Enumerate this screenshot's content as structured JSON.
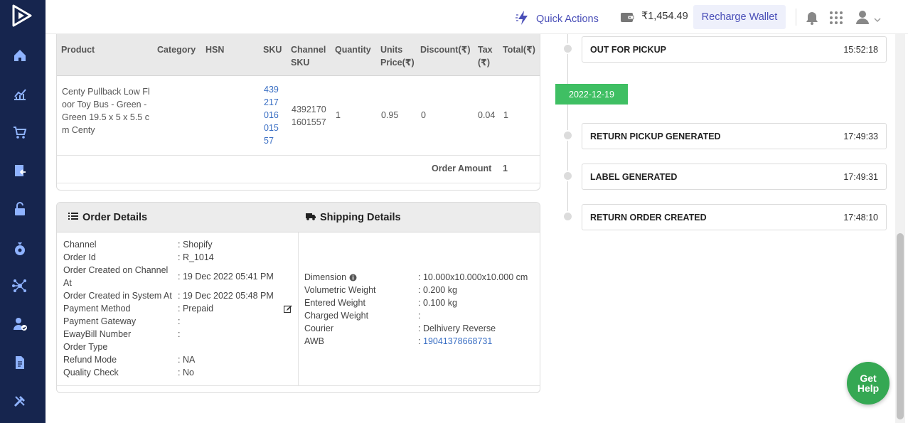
{
  "topbar": {
    "quick_actions": "Quick Actions",
    "wallet_amount": "₹1,454.49",
    "recharge_label": "Recharge Wallet"
  },
  "product_table": {
    "headers": {
      "product": "Product",
      "category": "Category",
      "hsn": "HSN",
      "sku": "SKU",
      "channel_sku_1": "Channel",
      "channel_sku_2": "SKU",
      "quantity": "Quantity",
      "units_price_1": "Units",
      "units_price_2": "Price(₹)",
      "discount": "Discount(₹)",
      "tax_1": "Tax",
      "tax_2": "(₹)",
      "total": "Total(₹)"
    },
    "row": {
      "product_lines": [
        "Centy Pullback Low Fl",
        "oor Toy Bus - Green -",
        "Green 19.5 x 5 x 5.5 c",
        "m Centy"
      ],
      "sku_lines": [
        "439",
        "217",
        "016",
        "015",
        "57"
      ],
      "channel_sku_lines": [
        "4392170",
        "1601557"
      ],
      "quantity": "1",
      "units_price": "0.95",
      "discount": "0",
      "tax": "0.04",
      "total": "1"
    },
    "order_amount_label": "Order Amount",
    "order_amount_value": "1"
  },
  "order_details": {
    "title": "Order Details",
    "fields": {
      "channel_label": "Channel",
      "channel_value": ": Shopify",
      "order_id_label": "Order Id",
      "order_id_value": ": R_1014",
      "created_channel_label_1": "Order Created on Channel",
      "created_channel_label_2": "At",
      "created_channel_value": ": 19 Dec 2022 05:41 PM",
      "created_system_label": "Order Created in System At",
      "created_system_value": ": 19 Dec 2022 05:48 PM",
      "payment_method_label": "Payment Method",
      "payment_method_value": ": Prepaid",
      "payment_gateway_label": "Payment Gateway",
      "payment_gateway_value": ":",
      "eway_label": "EwayBill Number",
      "eway_value": ":",
      "order_type_label": "Order Type",
      "refund_mode_label": "Refund Mode",
      "refund_mode_value": ": NA",
      "quality_check_label": "Quality Check",
      "quality_check_value": ": No"
    }
  },
  "shipping_details": {
    "title": "Shipping Details",
    "fields": {
      "dimension_label": "Dimension",
      "dimension_value": ": 10.000x10.000x10.000 cm",
      "vol_weight_label": "Volumetric Weight",
      "vol_weight_value": ":  0.200 kg",
      "entered_weight_label": "Entered Weight",
      "entered_weight_value": ":  0.100 kg",
      "charged_weight_label": "Charged Weight",
      "charged_weight_value": ":",
      "courier_label": "Courier",
      "courier_value": ": Delhivery Reverse",
      "awb_label": "AWB",
      "awb_colon": ":",
      "awb_value": "19041378668731"
    }
  },
  "timeline": {
    "date_pill": "2022-12-19",
    "events": [
      {
        "status": "OUT FOR PICKUP",
        "time": "15:52:18"
      },
      {
        "status": "RETURN PICKUP GENERATED",
        "time": "17:49:33"
      },
      {
        "status": "LABEL GENERATED",
        "time": "17:49:31"
      },
      {
        "status": "RETURN ORDER CREATED",
        "time": "17:48:10"
      }
    ]
  },
  "help": {
    "line1": "Get",
    "line2": "Help"
  },
  "colors": {
    "sidebar": "#16254e",
    "accent": "#4a4fb8",
    "green": "#3fbf63",
    "link": "#3a6fc4"
  },
  "icons": [
    "logo-icon",
    "home-icon",
    "analytics-icon",
    "cart-icon",
    "returns-icon",
    "unlock-icon",
    "money-bag-icon",
    "network-icon",
    "user-check-icon",
    "document-icon",
    "tools-icon",
    "lightning-icon",
    "wallet-icon",
    "bell-icon",
    "apps-grid-icon",
    "user-icon",
    "chevron-down-icon",
    "list-icon",
    "truck-icon",
    "info-icon",
    "edit-icon"
  ]
}
